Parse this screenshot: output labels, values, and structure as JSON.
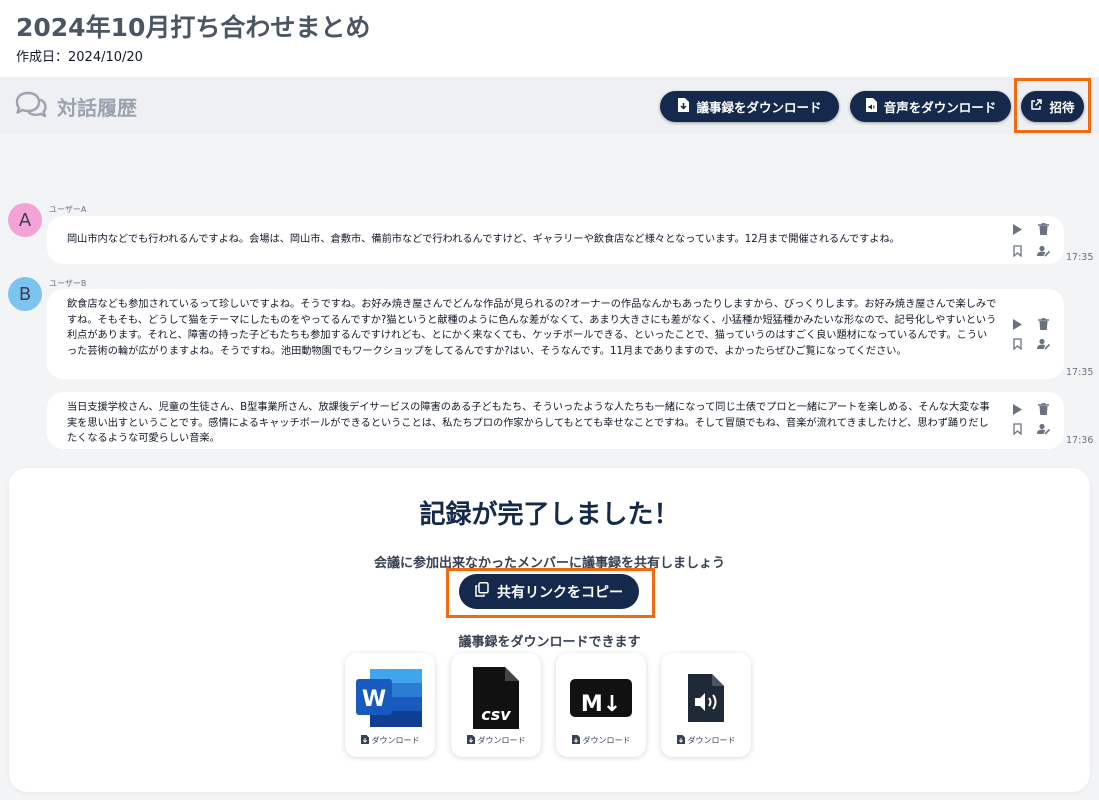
{
  "page": {
    "title": "2024年10月打ち合わせまとめ",
    "created": "作成日：2024/10/20"
  },
  "history": {
    "title": "対話履歴",
    "download_minutes_label": "議事録をダウンロード",
    "download_audio_label": "音声をダウンロード",
    "invite_label": "招待"
  },
  "messages": [
    {
      "avatar": "A",
      "avatar_color": "#f4a3d6",
      "user": "ユーザーA",
      "text": "岡山市内などでも行われるんですよね。会場は、岡山市、倉敷市、備前市などで行われるんですけど、ギャラリーや飲食店など様々となっています。12月まで開催されるんですよね。",
      "time": "17:35"
    },
    {
      "avatar": "B",
      "avatar_color": "#7cc4f0",
      "user": "ユーザーB",
      "text": "飲食店なども参加されているって珍しいですよね。そうですね。お好み焼き屋さんでどんな作品が見られるの?オーナーの作品なんかもあったりしますから、びっくりします。お好み焼き屋さんで楽しみですね。そもそも、どうして猫をテーマにしたものをやってるんですか?猫というと献種のように色んな差がなくて、あまり大きさにも差がなく、小猛種か短猛種かみたいな形なので、記号化しやすいという利点があります。それと、障害の持った子どもたちも参加するんですけれども、とにかく来なくても、ケッチボールできる、といったことで、猫っていうのはすごく良い題材になっているんです。こういった芸術の輪が広がりますよね。そうですね。池田動物園でもワークショップをしてるんですか?はい、そうなんです。11月までありますので、よかったらぜひご覧になってください。",
      "time": "17:35"
    },
    {
      "avatar": "",
      "avatar_color": "",
      "user": "",
      "text": "当日支援学校さん、児童の生徒さん、B型事業所さん、放課後デイサービスの障害のある子どもたち、そういったような人たちも一緒になって同じ土俵でプロと一緒にアートを楽しめる、そんな大変な事実を思い出すということです。感情によるキャッチボールができるということは、私たちプロの作家からしてもとても幸せなことですね。そして冒頭でもね、音楽が流れてきましたけど、思わず踊りだしたくなるような可愛らしい音楽。",
      "time": "17:36"
    }
  ],
  "completion": {
    "title": "記録が完了しました！",
    "share_text": "会議に参加出来なかったメンバーに議事録を共有しましょう",
    "copy_label": "共有リンクをコピー",
    "download_text": "議事録をダウンロードできます",
    "files": [
      {
        "type": "word",
        "icon": "word-icon",
        "label": "ダウンロード",
        "badge": "W"
      },
      {
        "type": "csv",
        "icon": "csv-icon",
        "label": "ダウンロード",
        "badge": "csv"
      },
      {
        "type": "markdown",
        "icon": "markdown-icon",
        "label": "ダウンロード",
        "badge": "M↓"
      },
      {
        "type": "audio",
        "icon": "audio-file-icon",
        "label": "ダウンロード",
        "badge": ""
      }
    ]
  },
  "colors": {
    "primary": "#14294b",
    "highlight": "#f26a10",
    "word_blue": "#185abd"
  }
}
